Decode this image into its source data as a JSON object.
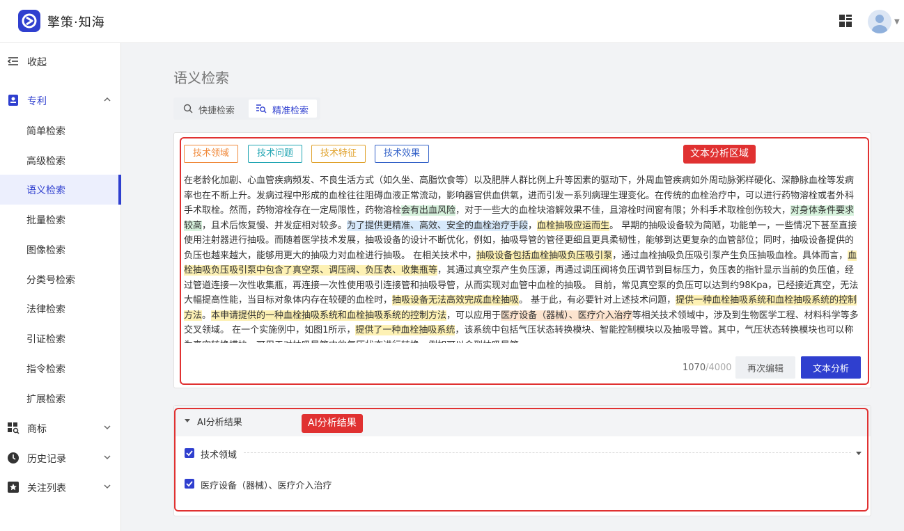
{
  "app": {
    "title": "擎策·知海"
  },
  "sidebar": {
    "collapse": "收起",
    "patent": "专利",
    "patent_items": [
      "简单检索",
      "高级检索",
      "语义检索",
      "批量检索",
      "图像检索",
      "分类号检索",
      "法律检索",
      "引证检索",
      "指令检索",
      "扩展检索"
    ],
    "trademark": "商标",
    "history": "历史记录",
    "watchlist": "关注列表"
  },
  "page": {
    "title": "语义检索",
    "tabs": {
      "fast": "快捷检索",
      "precise": "精准检索"
    }
  },
  "analysis": {
    "chips": [
      "技术领域",
      "技术问题",
      "技术特征",
      "技术效果"
    ],
    "area_label": "文本分析区域",
    "text_segments": [
      {
        "t": "在老龄化加剧、心血管疾病频发、不良生活方式（如久坐、高脂饮食等）以及肥胖人群比例上升等因素的驱动下，外周血管疾病如外周动脉粥样硬化、深静脉血栓等发病率也在不断上升。发病过程中形成的血栓往往阻碍血液正常流动，影响器官供血供氧，进而引发一系列病理生理变化。在传统的血栓治疗中，可以进行药物溶栓或者外科手术取栓。然而，药物溶栓存在一定局限性，药物溶栓",
        "h": ""
      },
      {
        "t": "会有出血风险",
        "h": "g"
      },
      {
        "t": "，对于一些大的血栓块溶解效果不佳，且溶栓时间窗有限；外科手术取栓创伤较大，",
        "h": ""
      },
      {
        "t": "对身体条件要求较高",
        "h": "g"
      },
      {
        "t": "，且术后恢复慢、并发症相对较多。",
        "h": ""
      },
      {
        "t": "为了提供更精准、高效、安全的血栓治疗手段",
        "h": "b"
      },
      {
        "t": "，",
        "h": ""
      },
      {
        "t": "血栓抽吸应运而生",
        "h": "y"
      },
      {
        "t": "。 早期的抽吸设备较为简陋，功能单一，一些情况下甚至直接使用注射器进行抽吸。而随着医学技术发展，抽吸设备的设计不断优化，例如，抽吸导管的管径更细且更具柔韧性，能够到达更复杂的血管部位；同时，抽吸设备提供的负压也越来越大，能够用更大的抽吸力对血栓进行抽吸。 在相关技术中，",
        "h": ""
      },
      {
        "t": "抽吸设备包括血栓抽吸负压吸引泵",
        "h": "y"
      },
      {
        "t": "，通过血栓抽吸负压吸引泵产生负压抽吸血栓。具体而言，",
        "h": ""
      },
      {
        "t": "血栓抽吸负压吸引泵中包含了真空泵、调压阀、负压表、收集瓶等",
        "h": "y"
      },
      {
        "t": "，其通过真空泵产生负压源，再通过调压阀将负压调节到目标压力，负压表的指针显示当前的负压值，经过管道连接一次性收集瓶，再连接一次性使用吸引连接管和抽吸导管，从而实现对血管中血栓的抽吸。 目前，常见真空泵的负压可以达到约98Kpa，已经接近真空，无法大幅提高性能，当目标对象体内存在较硬的血栓时，",
        "h": ""
      },
      {
        "t": "抽吸设备无法高效完成血栓抽吸",
        "h": "y"
      },
      {
        "t": "。 基于此，有必要针对上述技术问题，",
        "h": ""
      },
      {
        "t": "提供一种血栓抽吸系统和血栓抽吸系统的控制方法",
        "h": "y"
      },
      {
        "t": "。",
        "h": ""
      },
      {
        "t": "本申请提供的一种血栓抽吸系统和血栓抽吸系统的控制方法",
        "h": "y"
      },
      {
        "t": "，可以应用于",
        "h": ""
      },
      {
        "t": "医疗设备（器械）、医疗介入治疗",
        "h": "o"
      },
      {
        "t": "等相关技术领域中，涉及到生物医学工程、材料科学等多交叉领域。 在一个实施例中，如图1所示，",
        "h": ""
      },
      {
        "t": "提供了一种血栓抽吸系统",
        "h": "y"
      },
      {
        "t": "，该系统中包括气压状态转换模块、智能控制模块以及抽吸导管。其中，气压状态转换模块也可以称为真空转换模块，可用于对抽吸导管内的气压状态进行转换，例如可以会到抽吸导管。",
        "h": ""
      }
    ],
    "count": "1070",
    "count_max": "/4000",
    "reedit_label": "再次编辑",
    "analyze_label": "文本分析"
  },
  "result": {
    "title": "AI分析结果",
    "tag": "AI分析结果",
    "rows": [
      "技术领域",
      "医疗设备（器械）、医疗介入治疗"
    ]
  }
}
